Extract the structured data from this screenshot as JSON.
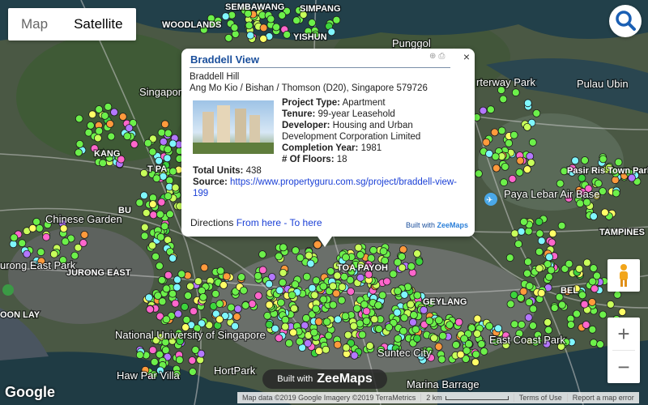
{
  "map_type": {
    "map": "Map",
    "satellite": "Satellite",
    "active": "Satellite"
  },
  "place_labels": [
    {
      "text": "WOODLANDS"
    },
    {
      "text": "SEMBAWANG"
    },
    {
      "text": "SIMPANG"
    },
    {
      "text": "YISHUN"
    },
    {
      "text": "Punggol"
    },
    {
      "text": "Singapore"
    },
    {
      "text": "Pulau Ubin"
    },
    {
      "text": "rterway Park"
    },
    {
      "text": "KANG"
    },
    {
      "text": "T PA"
    },
    {
      "text": "Pasir Ris Town Park"
    },
    {
      "text": "Paya Lebar Air Base"
    },
    {
      "text": "Chinese Garden"
    },
    {
      "text": "BU"
    },
    {
      "text": "TOA PAYOH"
    },
    {
      "text": "TAMPINES"
    },
    {
      "text": "urong East Park"
    },
    {
      "text": "JURONG EAST"
    },
    {
      "text": "BEL"
    },
    {
      "text": "OON LAY"
    },
    {
      "text": "GEYLANG"
    },
    {
      "text": "National University of Singapore"
    },
    {
      "text": "East Coast Park"
    },
    {
      "text": "Haw Par Villa"
    },
    {
      "text": "HortPark"
    },
    {
      "text": "Marina Barrage"
    },
    {
      "text": "Suntec City"
    }
  ],
  "popup": {
    "title": "Braddell View",
    "address_line1": "Braddell Hill",
    "address_line2": "Ang Mo Kio / Bishan / Thomson (D20), Singapore 579726",
    "project_type_label": "Project Type:",
    "project_type": "Apartment",
    "tenure_label": "Tenure:",
    "tenure": "99-year Leasehold",
    "developer_label": "Developer:",
    "developer": "Housing and Urban Development Corporation Limited",
    "completion_label": "Completion Year:",
    "completion_year": "1981",
    "floors_label": "# Of Floors:",
    "floors": "18",
    "total_units_label": "Total Units:",
    "total_units": "438",
    "source_label": "Source:",
    "source_url": "https://www.propertyguru.com.sg/project/braddell-view-199",
    "directions_label": "Directions",
    "from_here": "From here",
    "dash": " - ",
    "to_here": "To here",
    "built_with": "Built with",
    "zeemaps": "ZeeMaps",
    "close": "×"
  },
  "banner": {
    "small": "Built with",
    "big": "ZeeMaps"
  },
  "zoom": {
    "in": "+",
    "out": "−"
  },
  "google_logo": "Google",
  "footer": {
    "map_data": "Map data ©2019 Google Imagery ©2019 TerraMetrics",
    "scale": "2 km",
    "terms": "Terms of Use",
    "report": "Report a map error"
  },
  "marker_colors": [
    "#6cf04a",
    "#c8ff5a",
    "#7ff7ff",
    "#ff66cc",
    "#ff9a3c",
    "#ffff66",
    "#b477ff",
    "#3cd43c",
    "#ffffff"
  ],
  "colors": {
    "land": "#4b5a44",
    "water": "#1f3b44",
    "road": "#c9c9c9",
    "title": "#1a4f9c",
    "link": "#1a3fd6"
  }
}
